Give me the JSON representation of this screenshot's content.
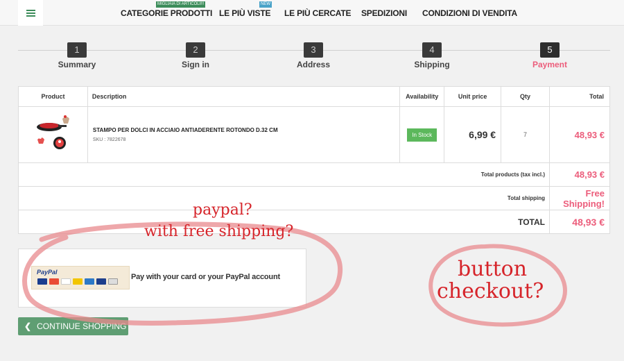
{
  "nav": {
    "items": [
      {
        "label": "CATEGORIE PRODOTTI",
        "badge": "MIGLIAIA DI ARTICOLI!!!"
      },
      {
        "label": "LE PIÙ VISTE",
        "badge": "NEW"
      },
      {
        "label": "LE PIÙ CERCATE"
      },
      {
        "label": "SPEDIZIONI"
      },
      {
        "label": "CONDIZIONI DI VENDITA"
      }
    ]
  },
  "steps": [
    {
      "num": "1",
      "label": "Summary"
    },
    {
      "num": "2",
      "label": "Sign in"
    },
    {
      "num": "3",
      "label": "Address"
    },
    {
      "num": "4",
      "label": "Shipping"
    },
    {
      "num": "5",
      "label": "Payment",
      "active": true
    }
  ],
  "table": {
    "headers": [
      "Product",
      "Description",
      "Availability",
      "Unit price",
      "Qty",
      "Total"
    ],
    "product": {
      "name": "STAMPO PER DOLCI IN ACCIAIO ANTIADERENTE ROTONDO D.32 CM",
      "sku": "SKU : 7822678",
      "availability": "In Stock",
      "unit_price": "6,99 €",
      "qty": "7",
      "total": "48,93 €"
    },
    "summary": {
      "products_label": "Total products (tax incl.)",
      "products_value": "48,93 €",
      "shipping_label": "Total shipping",
      "shipping_value": "Free Shipping!",
      "total_label": "TOTAL",
      "total_value": "48,93 €"
    }
  },
  "payment": {
    "logo_text": "PayPal",
    "label": "Pay with your card or your PayPal account"
  },
  "continue_label": "CONTINUE SHOPPING",
  "annotations": {
    "paypal_line1": "paypal?",
    "paypal_line2": "with free shipping?",
    "button_line1": "button",
    "button_line2": "checkout?"
  },
  "colors": {
    "accent_pink": "#ec5d7b",
    "brand_green": "#3c8c5a",
    "stock_green": "#5cb85c",
    "annotation_red": "#d6242a"
  }
}
